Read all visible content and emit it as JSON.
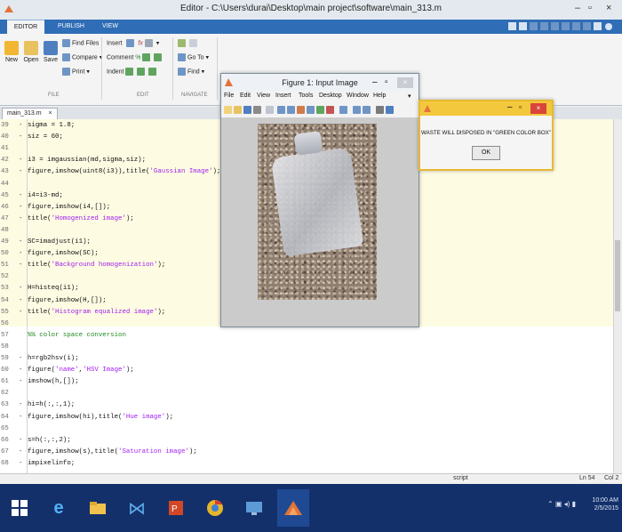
{
  "window": {
    "title": "Editor - C:\\Users\\durai\\Desktop\\main project\\software\\main_313.m",
    "min": "–",
    "max": "▫",
    "close": "×"
  },
  "ribbon": {
    "tabs": [
      "EDITOR",
      "PUBLISH",
      "VIEW"
    ],
    "active_tab": "EDITOR",
    "file_group": {
      "new": "New",
      "open": "Open",
      "save": "Save",
      "find_files": "Find Files",
      "compare": "Compare",
      "print": "Print",
      "label": "FILE"
    },
    "edit_group": {
      "insert": "Insert",
      "comment": "Comment",
      "indent": "Indent",
      "label": "EDIT"
    },
    "navigate_group": {
      "go_to": "Go To",
      "find": "Find",
      "label": "NAVIGATE"
    }
  },
  "file_tab": {
    "label": "main_313.m",
    "close": "×"
  },
  "code_lines": [
    {
      "n": "39",
      "mark": "-",
      "parts": [
        [
          "sigma = 1.8;",
          ""
        ]
      ]
    },
    {
      "n": "40",
      "mark": "-",
      "parts": [
        [
          "siz = 60;",
          ""
        ]
      ]
    },
    {
      "n": "41",
      "mark": "",
      "parts": []
    },
    {
      "n": "42",
      "mark": "-",
      "parts": [
        [
          "i3 = imgaussian(md,sigma,siz);",
          ""
        ]
      ]
    },
    {
      "n": "43",
      "mark": "-",
      "parts": [
        [
          "figure,imshow(uint8(i3)),title(",
          ""
        ],
        [
          "'Gaussian Image'",
          "str"
        ],
        [
          ");",
          ""
        ]
      ]
    },
    {
      "n": "44",
      "mark": "",
      "parts": []
    },
    {
      "n": "45",
      "mark": "-",
      "parts": [
        [
          "i4=i3-md;",
          ""
        ]
      ]
    },
    {
      "n": "46",
      "mark": "-",
      "parts": [
        [
          "figure,imshow(i4,[]);",
          ""
        ]
      ]
    },
    {
      "n": "47",
      "mark": "-",
      "parts": [
        [
          "title(",
          ""
        ],
        [
          "'Homogenized image'",
          "str"
        ],
        [
          ");",
          ""
        ]
      ]
    },
    {
      "n": "48",
      "mark": "",
      "parts": []
    },
    {
      "n": "49",
      "mark": "-",
      "parts": [
        [
          "SC=imadjust(i1);",
          ""
        ]
      ]
    },
    {
      "n": "50",
      "mark": "-",
      "parts": [
        [
          "figure,imshow(SC);",
          ""
        ]
      ]
    },
    {
      "n": "51",
      "mark": "-",
      "parts": [
        [
          "title(",
          ""
        ],
        [
          "'Background homogenization'",
          "str"
        ],
        [
          ");",
          ""
        ]
      ]
    },
    {
      "n": "52",
      "mark": "",
      "parts": []
    },
    {
      "n": "53",
      "mark": "-",
      "parts": [
        [
          "H=histeq(i1);",
          ""
        ]
      ]
    },
    {
      "n": "54",
      "mark": "-",
      "parts": [
        [
          "figure,imshow(H,[]);",
          ""
        ]
      ]
    },
    {
      "n": "55",
      "mark": "-",
      "parts": [
        [
          "title(",
          ""
        ],
        [
          "'Histogram equalized image'",
          "str"
        ],
        [
          ");",
          ""
        ]
      ]
    },
    {
      "n": "56",
      "mark": "",
      "parts": []
    },
    {
      "n": "57",
      "mark": "",
      "parts": [
        [
          "%% color space conversion",
          "cmt"
        ]
      ]
    },
    {
      "n": "58",
      "mark": "",
      "parts": []
    },
    {
      "n": "59",
      "mark": "-",
      "parts": [
        [
          "h=rgb2hsv(i);",
          ""
        ]
      ]
    },
    {
      "n": "60",
      "mark": "-",
      "parts": [
        [
          "figure(",
          ""
        ],
        [
          "'name'",
          "str"
        ],
        [
          ",",
          ""
        ],
        [
          "'HSV Image'",
          "str"
        ],
        [
          ");",
          ""
        ]
      ]
    },
    {
      "n": "61",
      "mark": "-",
      "parts": [
        [
          "imshow(h,[]);",
          ""
        ]
      ]
    },
    {
      "n": "62",
      "mark": "",
      "parts": []
    },
    {
      "n": "63",
      "mark": "-",
      "parts": [
        [
          "hi=h(:,:,1);",
          ""
        ]
      ]
    },
    {
      "n": "64",
      "mark": "-",
      "parts": [
        [
          "figure,imshow(hi),title(",
          ""
        ],
        [
          "'Hue image'",
          "str"
        ],
        [
          ");",
          ""
        ]
      ]
    },
    {
      "n": "65",
      "mark": "",
      "parts": []
    },
    {
      "n": "66",
      "mark": "-",
      "parts": [
        [
          "s=h(:,:,2);",
          ""
        ]
      ]
    },
    {
      "n": "67",
      "mark": "-",
      "parts": [
        [
          "figure,imshow(s),title(",
          ""
        ],
        [
          "'Saturation image'",
          "str"
        ],
        [
          ");",
          ""
        ]
      ]
    },
    {
      "n": "68",
      "mark": "-",
      "parts": [
        [
          "impixelinfo;",
          ""
        ]
      ]
    }
  ],
  "figure": {
    "title": "Figure 1: Input Image",
    "menu": [
      "File",
      "Edit",
      "View",
      "Insert",
      "Tools",
      "Desktop",
      "Window",
      "Help"
    ]
  },
  "dialog": {
    "message": "WASTE WILL DISPOSED IN \"GREEN COLOR BOX\"",
    "ok": "OK"
  },
  "status": {
    "mode": "script",
    "line": "Ln 54",
    "col": "Col 2"
  },
  "tray": {
    "time": "10:00 AM",
    "date": "2/5/2015"
  },
  "colors": {
    "ribbon_blue": "#2f6db6",
    "taskbar": "#13306b",
    "cell_highlight": "#fdfbe2",
    "dialog_border": "#e8b931",
    "string": "#a020f0",
    "comment": "#228b22"
  }
}
